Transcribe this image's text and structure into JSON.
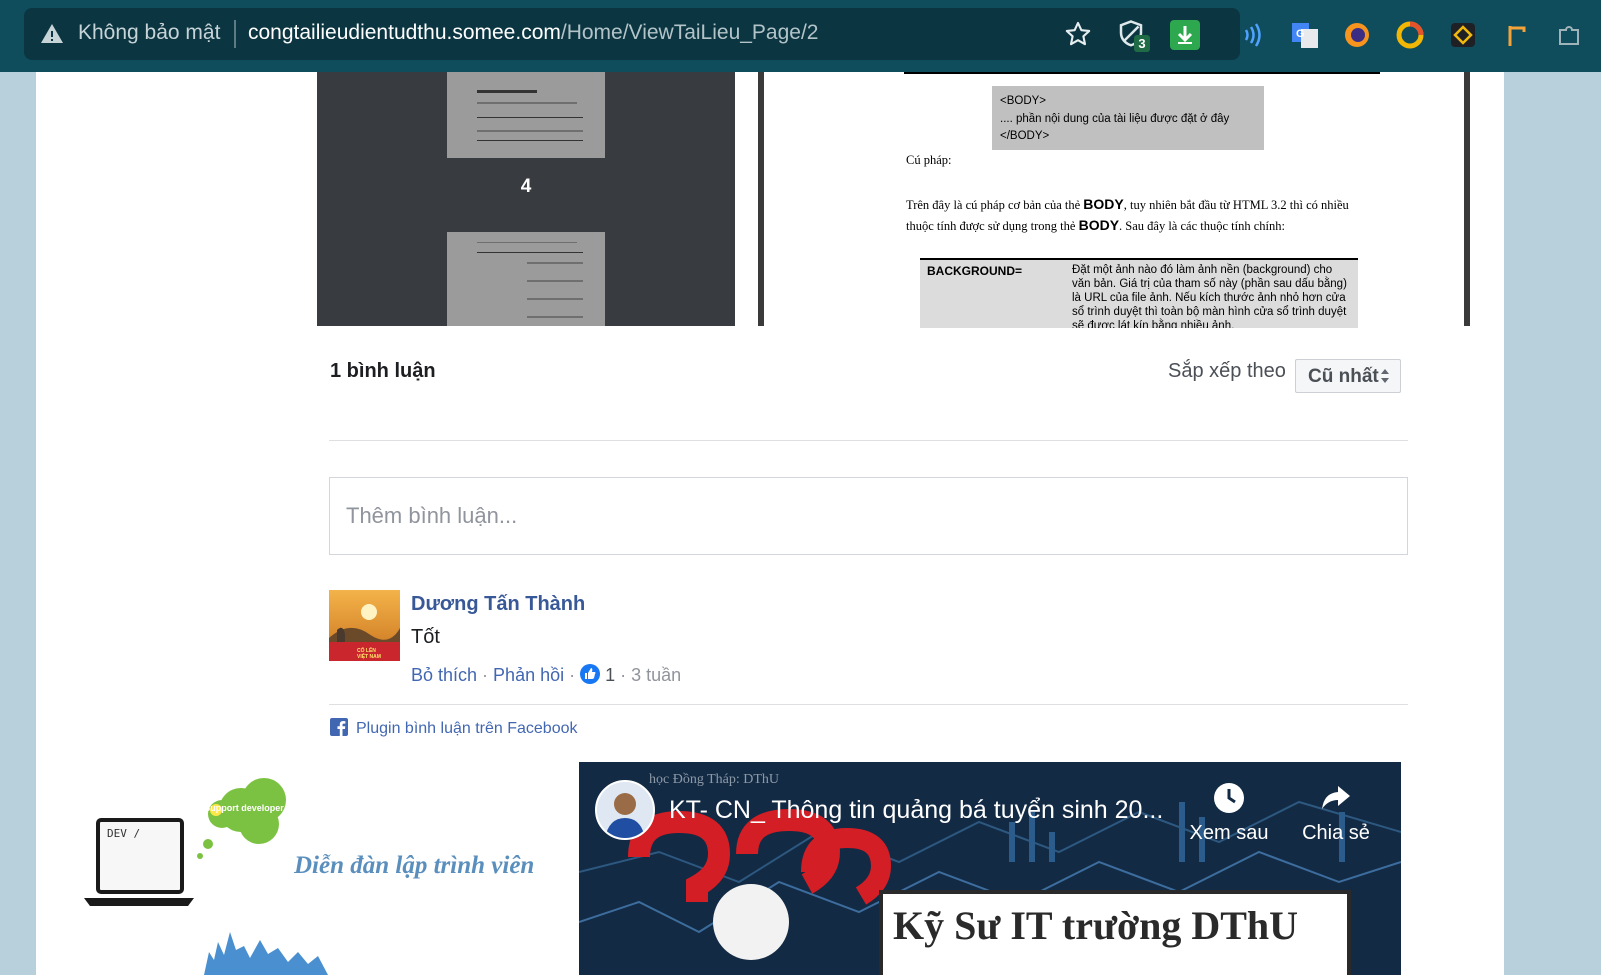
{
  "browser": {
    "security_label": "Không bảo mật",
    "url_host": "congtailieudientudthu.somee.com",
    "url_path": "/Home/ViewTaiLieu_Page/2",
    "extension_badge": "3"
  },
  "viewer": {
    "page_number": "4",
    "code_lines": [
      "<BODY>",
      ".... phần nội dung của tài liệu được đặt ở đây",
      "</BODY>"
    ],
    "syntax_label": "Cú pháp:",
    "paragraph_1_before": "Trên đây là cú pháp cơ bản của thẻ ",
    "paragraph_tag": "BODY",
    "paragraph_1_after": ", tuy nhiên bắt đầu từ HTML 3.2 thì có nhiều",
    "paragraph_2_before": "thuộc tính được sử dụng trong thẻ ",
    "paragraph_2_after": ". Sau đây là các thuộc tính chính:",
    "attr_name": "BACKGROUND=",
    "attr_desc": "Đặt một ảnh nào đó làm ảnh nền (background) cho văn bản. Giá trị của tham số này (phần sau dấu bằng) là URL của file ảnh. Nếu kích thước ảnh nhỏ hơn cửa sổ trình duyệt thì toàn bộ màn hình cửa sổ trình duyệt sẽ được lát kín bằng nhiều ảnh."
  },
  "comments": {
    "count_label": "1 bình luận",
    "sort_label": "Sắp xếp theo",
    "sort_value": "Cũ nhất",
    "input_placeholder": "Thêm bình luận...",
    "items": [
      {
        "author": "Dương Tấn Thành",
        "text": "Tốt",
        "like_action": "Bỏ thích",
        "reply_action": "Phản hồi",
        "likes": "1",
        "time": "3 tuần",
        "avatar_caption": "CỐ LÊN VIỆT NAM"
      }
    ],
    "plugin_label": "Plugin bình luận trên Facebook"
  },
  "banner": {
    "cloud_text": "Support developer",
    "laptop_text": "DEV /",
    "forum_text": "Diễn đàn lập trình viên"
  },
  "video": {
    "channel": "học Đồng Tháp: DThU",
    "title": "KT- CN_ Thông tin quảng bá tuyển sinh 20...",
    "watch_later": "Xem sau",
    "share": "Chia sẻ",
    "headline": "Kỹ Sư IT trường DThU"
  }
}
